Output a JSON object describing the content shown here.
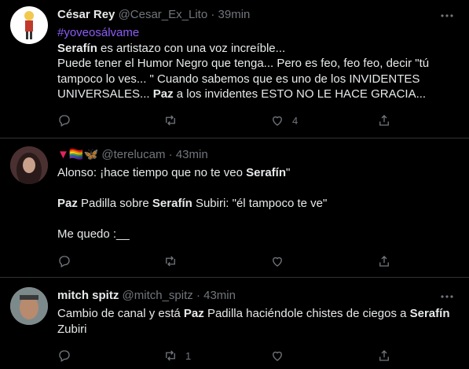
{
  "tweets": [
    {
      "name": "César Rey",
      "handle": "@Cesar_Ex_Lito",
      "separator": "·",
      "time": "39min",
      "hashtag": "#yoveosálvame",
      "lines": [
        [
          {
            "b": "Serafín"
          },
          {
            "t": " es artistazo con una voz increíble..."
          }
        ],
        [
          {
            "t": "Puede tener el Humor Negro que tenga... Pero es feo, feo feo, decir \"tú"
          }
        ],
        [
          {
            "t": "tampoco lo ves... \" Cuando sabemos que es uno de los INVIDENTES"
          }
        ],
        [
          {
            "t": "UNIVERSALES... "
          },
          {
            "b": "Paz"
          },
          {
            "t": " a los invidentes ESTO NO LE HACE GRACIA..."
          }
        ]
      ],
      "like_count": "4",
      "retweet_count": ""
    },
    {
      "name": "",
      "name_emoji": "▼🏳️‍🌈🦋",
      "handle": "@terelucam",
      "separator": "·",
      "time": "43min",
      "lines": [
        [
          {
            "t": "Alonso: ¡hace tiempo que no te veo "
          },
          {
            "b": "Serafín"
          },
          {
            "t": "\""
          }
        ],
        [],
        [
          {
            "b": "Paz"
          },
          {
            "t": " Padilla sobre "
          },
          {
            "b": "Serafín"
          },
          {
            "t": " Subiri: \"él tampoco te ve\""
          }
        ],
        [],
        [
          {
            "t": "Me quedo :__"
          }
        ]
      ],
      "like_count": "",
      "retweet_count": ""
    },
    {
      "name": "mitch spitz",
      "handle": "@mitch_spitz",
      "separator": "·",
      "time": "43min",
      "lines": [
        [
          {
            "t": "Cambio de canal y está "
          },
          {
            "b": "Paz"
          },
          {
            "t": " Padilla haciéndole chistes de ciegos a "
          },
          {
            "b": "Serafín"
          }
        ],
        [
          {
            "t": "Zubiri"
          }
        ]
      ],
      "like_count": "",
      "retweet_count": "1"
    }
  ],
  "colors": {
    "background": "#000000",
    "hashtag": "#8b5cf6",
    "muted": "#71767b",
    "divider": "#2f3336"
  },
  "icons": [
    "reply-icon",
    "retweet-icon",
    "like-icon",
    "share-icon",
    "more-icon"
  ]
}
